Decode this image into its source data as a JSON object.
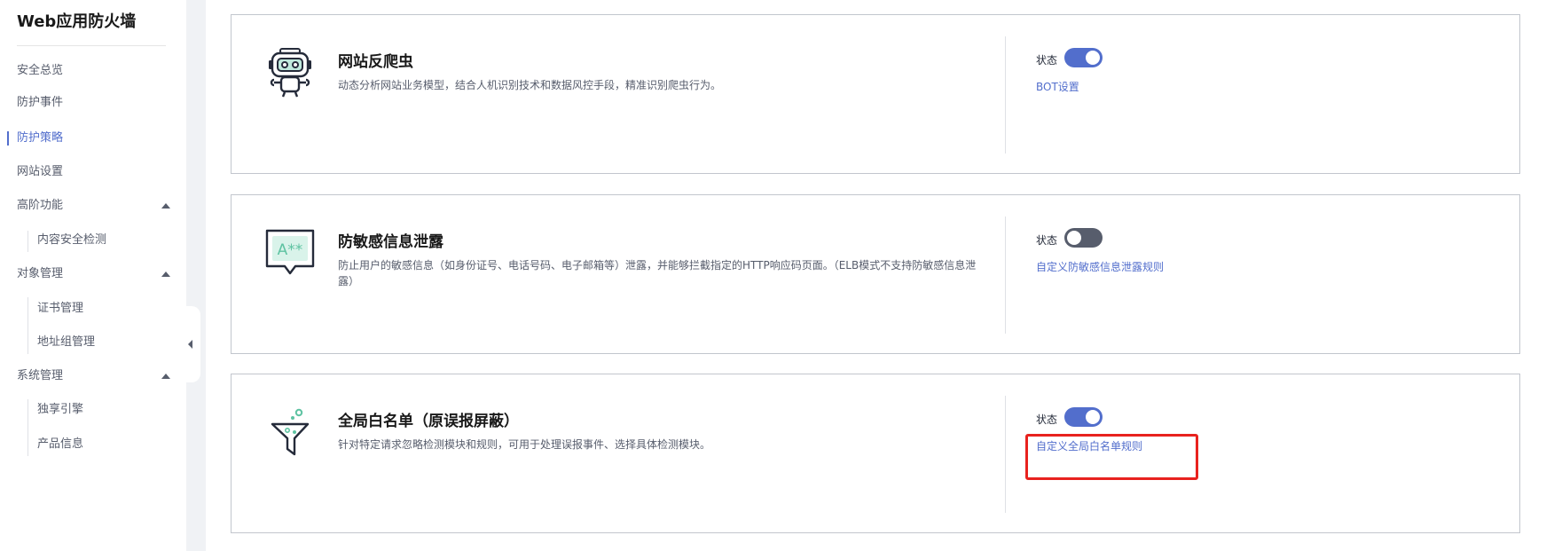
{
  "sidebar": {
    "title": "Web应用防火墙",
    "items": [
      {
        "label": "安全总览"
      },
      {
        "label": "防护事件"
      },
      {
        "label": "防护策略"
      },
      {
        "label": "网站设置"
      },
      {
        "label": "高阶功能"
      },
      {
        "label": "内容安全检测"
      },
      {
        "label": "对象管理"
      },
      {
        "label": "证书管理"
      },
      {
        "label": "地址组管理"
      },
      {
        "label": "系统管理"
      },
      {
        "label": "独享引擎"
      },
      {
        "label": "产品信息"
      }
    ],
    "active_item": "防护策略"
  },
  "cards": [
    {
      "title": "网站反爬虫",
      "description": "动态分析网站业务模型，结合人机识别技术和数据风控手段，精准识别爬虫行为。",
      "status_label": "状态",
      "status_on": true,
      "link": "BOT设置",
      "icon": "robot-icon"
    },
    {
      "title": "防敏感信息泄露",
      "description": "防止用户的敏感信息（如身份证号、电话号码、电子邮箱等）泄露，并能够拦截指定的HTTP响应码页面。（ELB模式不支持防敏感信息泄露）",
      "status_label": "状态",
      "status_on": false,
      "link": "自定义防敏感信息泄露规则",
      "icon": "masked-text-icon",
      "icon_text": "A**"
    },
    {
      "title": "全局白名单（原误报屏蔽）",
      "description": "针对特定请求忽略检测模块和规则，可用于处理误报事件、选择具体检测模块。",
      "status_label": "状态",
      "status_on": true,
      "link": "自定义全局白名单规则",
      "icon": "funnel-icon"
    }
  ],
  "colors": {
    "accent": "#526ecc",
    "toggle_off": "#575d6c",
    "highlight": "#e8221e",
    "icon_green": "#5ec3a2"
  }
}
